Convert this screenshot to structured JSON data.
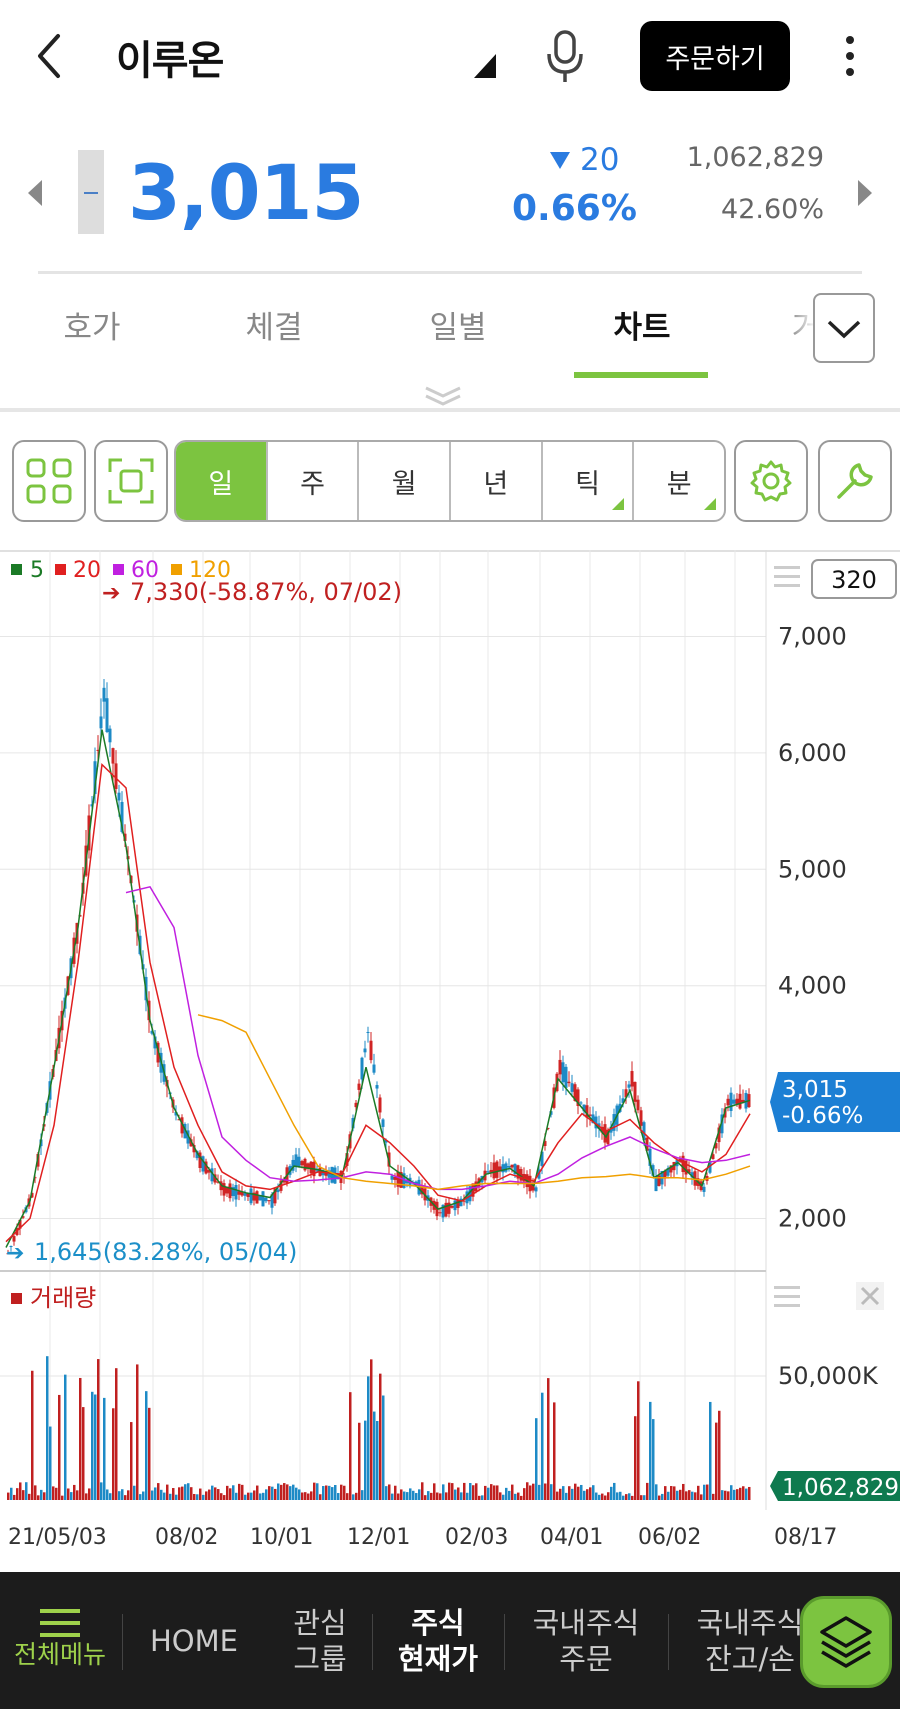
{
  "header": {
    "stock_name": "이루온",
    "order_label": "주문하기"
  },
  "quote": {
    "price": "3,015",
    "change": "20",
    "change_pct": "0.66%",
    "volume": "1,062,829",
    "ratio": "42.60%"
  },
  "tabs": [
    {
      "label": "호가"
    },
    {
      "label": "체결"
    },
    {
      "label": "일별"
    },
    {
      "label": "차트"
    },
    {
      "label": "거"
    }
  ],
  "periods": [
    {
      "label": "일"
    },
    {
      "label": "주"
    },
    {
      "label": "월"
    },
    {
      "label": "년"
    },
    {
      "label": "틱"
    },
    {
      "label": "분"
    }
  ],
  "chart_legend": {
    "ma": [
      {
        "label": "5",
        "color": "#1b7a26"
      },
      {
        "label": "20",
        "color": "#e02020"
      },
      {
        "label": "60",
        "color": "#c020e0"
      },
      {
        "label": "120",
        "color": "#f0a000"
      }
    ],
    "count": "320",
    "high_note": "7,330(-58.87%, 07/02)",
    "low_note": "1,645(83.28%, 05/04)",
    "last_price": "3,015",
    "last_change": "-0.66%",
    "volume_title": "거래량",
    "volume_last": "1,062,829"
  },
  "chart_data": {
    "type": "line",
    "price_ticks": [
      "7,000",
      "6,000",
      "5,000",
      "4,000",
      "2,000"
    ],
    "volume_tick": "50,000K",
    "x_ticks": [
      "21/05/03",
      "08/02",
      "10/01",
      "12/01",
      "02/03",
      "04/01",
      "06/02",
      "08/17"
    ],
    "ylim": [
      1600,
      7400
    ],
    "series": [
      {
        "name": "price",
        "x": [
          "05/03",
          "05/17",
          "06/01",
          "06/15",
          "07/02",
          "07/16",
          "08/02",
          "08/17",
          "09/01",
          "09/15",
          "10/01",
          "10/15",
          "11/01",
          "11/15",
          "12/01",
          "12/15",
          "01/03",
          "01/17",
          "02/03",
          "02/17",
          "03/02",
          "03/16",
          "04/01",
          "04/15",
          "05/02",
          "05/16",
          "06/02",
          "06/16",
          "07/01",
          "07/15",
          "08/01",
          "08/17"
        ],
        "values": [
          1700,
          2200,
          3400,
          4600,
          6500,
          5100,
          3600,
          2900,
          2500,
          2250,
          2200,
          2150,
          2500,
          2400,
          2350,
          3600,
          2350,
          2300,
          2050,
          2150,
          2400,
          2450,
          2250,
          3300,
          2950,
          2700,
          3200,
          2300,
          2500,
          2250,
          3000,
          3015
        ]
      },
      {
        "name": "5",
        "values": [
          1750,
          2150,
          3300,
          4500,
          6200,
          5200,
          3700,
          2950,
          2550,
          2280,
          2220,
          2180,
          2450,
          2420,
          2360,
          3300,
          2450,
          2300,
          2080,
          2150,
          2380,
          2430,
          2280,
          3200,
          2950,
          2700,
          3100,
          2350,
          2480,
          2280,
          2950,
          3015
        ]
      },
      {
        "name": "20",
        "values": [
          1800,
          2000,
          2800,
          4200,
          5900,
          5700,
          4200,
          3300,
          2800,
          2400,
          2280,
          2250,
          2320,
          2400,
          2380,
          2800,
          2650,
          2450,
          2200,
          2150,
          2280,
          2380,
          2320,
          2650,
          2900,
          2750,
          2850,
          2650,
          2500,
          2400,
          2550,
          2900
        ]
      },
      {
        "name": "60",
        "values": [
          null,
          null,
          null,
          null,
          null,
          4800,
          4850,
          4500,
          3400,
          2700,
          2500,
          2350,
          2320,
          2330,
          2350,
          2400,
          2380,
          2300,
          2250,
          2250,
          2280,
          2320,
          2300,
          2380,
          2520,
          2620,
          2700,
          2600,
          2520,
          2480,
          2500,
          2550
        ]
      },
      {
        "name": "120",
        "values": [
          null,
          null,
          null,
          null,
          null,
          null,
          null,
          null,
          3750,
          3700,
          3600,
          3200,
          2800,
          2450,
          2350,
          2320,
          2300,
          2280,
          2250,
          2280,
          2300,
          2300,
          2300,
          2320,
          2350,
          2360,
          2380,
          2350,
          2350,
          2330,
          2380,
          2450
        ]
      }
    ]
  },
  "bottom_nav": [
    {
      "label": "전체메뉴"
    },
    {
      "label": "HOME"
    },
    {
      "label": "관심\n그룹"
    },
    {
      "label": "주식\n현재가"
    },
    {
      "label": "국내주식\n주문"
    },
    {
      "label": "국내주식\n잔고/손"
    }
  ]
}
